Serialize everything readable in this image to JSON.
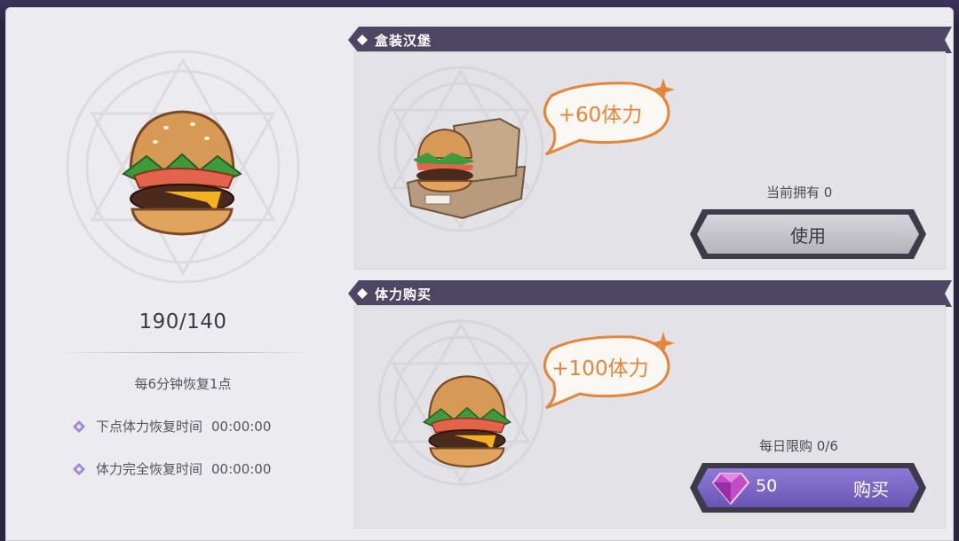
{
  "left": {
    "stamina": "190/140",
    "recover_rate": "每6分钟恢复1点",
    "next_label": "下点体力恢复时间",
    "next_time": "00:00:00",
    "full_label": "体力完全恢复时间",
    "full_time": "00:00:00"
  },
  "boxed": {
    "title": "盒装汉堡",
    "bonus": "+60体力",
    "owned": "当前拥有 0",
    "button": "使用"
  },
  "purchase": {
    "title": "体力购买",
    "bonus": "+100体力",
    "limit": "每日限购 0/6",
    "price": "50",
    "button": "购买"
  },
  "colors": {
    "accent_orange": "#e4863a",
    "header_purple": "#4e4763",
    "buy_button": "#7c67c5"
  },
  "icons": [
    "burger-icon",
    "boxed-burger-icon",
    "gem-icon",
    "diamond-bullet-icon",
    "sparkle-icon"
  ]
}
